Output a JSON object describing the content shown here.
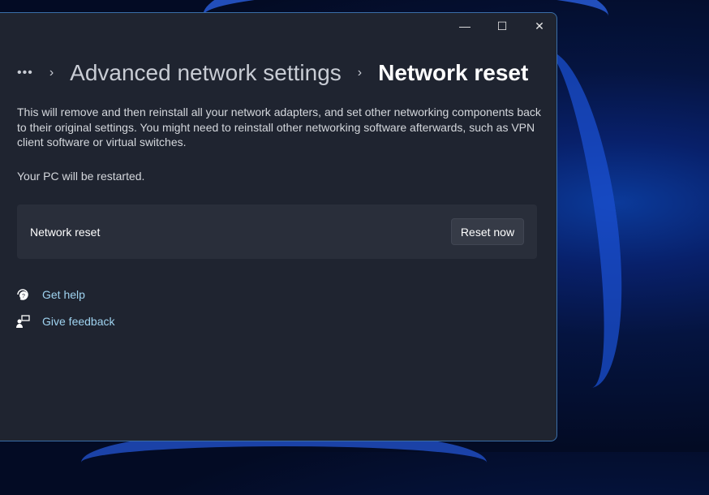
{
  "window": {
    "controls": {
      "minimize": "—",
      "maximize": "☐",
      "close": "✕"
    }
  },
  "breadcrumb": {
    "overflow": "•••",
    "parent": "Advanced network settings",
    "current": "Network reset",
    "separator": "›"
  },
  "description": "This will remove and then reinstall all your network adapters, and set other networking components back to their original settings. You might need to reinstall other networking software afterwards, such as VPN client software or virtual switches.",
  "restart_note": "Your PC will be restarted.",
  "card": {
    "label": "Network reset",
    "button": "Reset now"
  },
  "links": [
    {
      "label": "Get help",
      "icon": "help-icon"
    },
    {
      "label": "Give feedback",
      "icon": "feedback-icon"
    }
  ]
}
